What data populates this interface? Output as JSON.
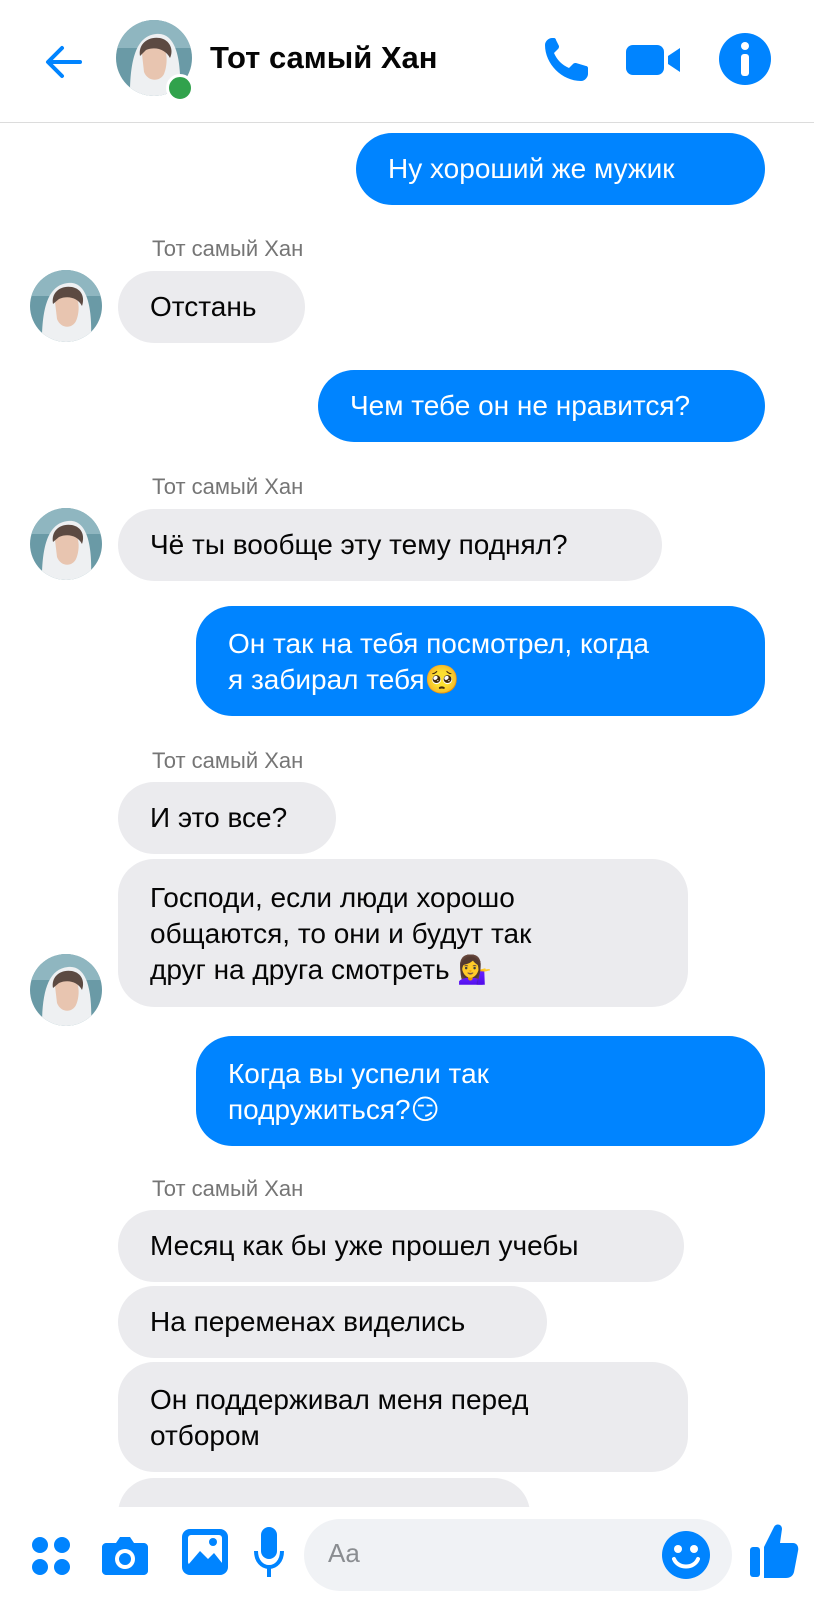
{
  "header": {
    "contact_name": "Тот самый Хан",
    "back_icon": "arrow-left-icon",
    "call_icon": "phone-icon",
    "video_icon": "video-camera-icon",
    "info_icon": "info-icon",
    "accent_color": "#0084ff",
    "online_color": "#31a24c"
  },
  "conversation": {
    "sender_label": "Тот самый Хан",
    "messages": [
      {
        "direction": "outgoing",
        "lines": [
          "Ну хороший же мужик"
        ]
      },
      {
        "direction": "incoming",
        "lines": [
          "Отстань"
        ]
      },
      {
        "direction": "outgoing",
        "lines": [
          "Чем тебе он не нравится?"
        ]
      },
      {
        "direction": "incoming",
        "lines": [
          "Чё ты вообще эту тему поднял?"
        ]
      },
      {
        "direction": "outgoing",
        "lines": [
          "Он так на тебя посмотрел, когда",
          "я забирал тебя🥺"
        ]
      },
      {
        "direction": "incoming",
        "lines": [
          "И это все?"
        ]
      },
      {
        "direction": "incoming",
        "lines": [
          "Господи, если люди хорошо",
          "общаются, то они и будут так",
          "друг на друга смотреть 💁‍♀️"
        ]
      },
      {
        "direction": "outgoing",
        "lines": [
          "Когда вы успели так",
          "подружиться?😏"
        ]
      },
      {
        "direction": "incoming",
        "lines": [
          "Месяц как бы уже прошел учебы"
        ]
      },
      {
        "direction": "incoming",
        "lines": [
          "На переменах виделись"
        ]
      },
      {
        "direction": "incoming",
        "lines": [
          "Он поддерживал меня перед",
          "отбором"
        ]
      }
    ]
  },
  "composer": {
    "placeholder": "Aa",
    "icons": [
      "menu-dots-icon",
      "camera-icon",
      "gallery-icon",
      "microphone-icon",
      "emoji-icon",
      "like-icon"
    ]
  }
}
